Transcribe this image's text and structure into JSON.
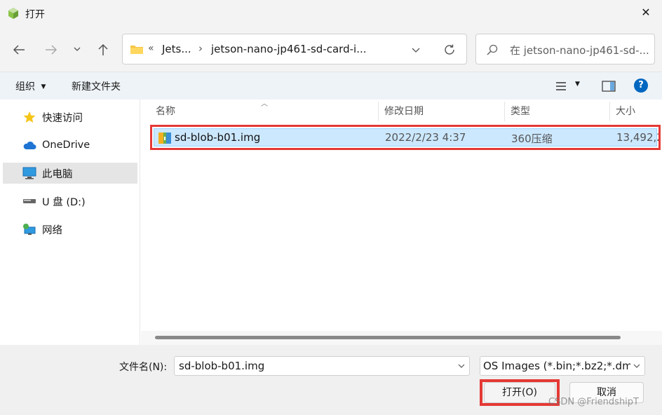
{
  "window": {
    "title": "打开",
    "close_glyph": "✕"
  },
  "address": {
    "segments": [
      "«",
      "Jets...",
      "›",
      "jetson-nano-jp461-sd-card-i..."
    ]
  },
  "search": {
    "placeholder": "在 jetson-nano-jp461-sd-..."
  },
  "toolbar": {
    "organize": "组织",
    "new_folder": "新建文件夹",
    "help": "?"
  },
  "sidebar": {
    "items": [
      {
        "label": "快速访问",
        "icon": "star-icon"
      },
      {
        "label": "OneDrive",
        "icon": "cloud-icon"
      },
      {
        "label": "此电脑",
        "icon": "computer-icon"
      },
      {
        "label": "U 盘 (D:)",
        "icon": "drive-icon"
      },
      {
        "label": "网络",
        "icon": "network-icon"
      }
    ],
    "selected": "此电脑"
  },
  "columns": {
    "name": "名称",
    "modified": "修改日期",
    "type": "类型",
    "size": "大小"
  },
  "files": [
    {
      "name": "sd-blob-b01.img",
      "modified": "2022/2/23 4:37",
      "type": "360压缩",
      "size": "13,492,2"
    }
  ],
  "footer": {
    "filename_label": "文件名(N):",
    "filename_value": "sd-blob-b01.img",
    "filter": "OS Images (*.bin;*.bz2;*.dmg",
    "open_button": "打开(O)",
    "cancel_button": "取消",
    "watermark": "CSDN @FriendshipT"
  },
  "colors": {
    "highlight": "#e53935",
    "selection": "#cce8ff",
    "accent": "#0067c0"
  }
}
